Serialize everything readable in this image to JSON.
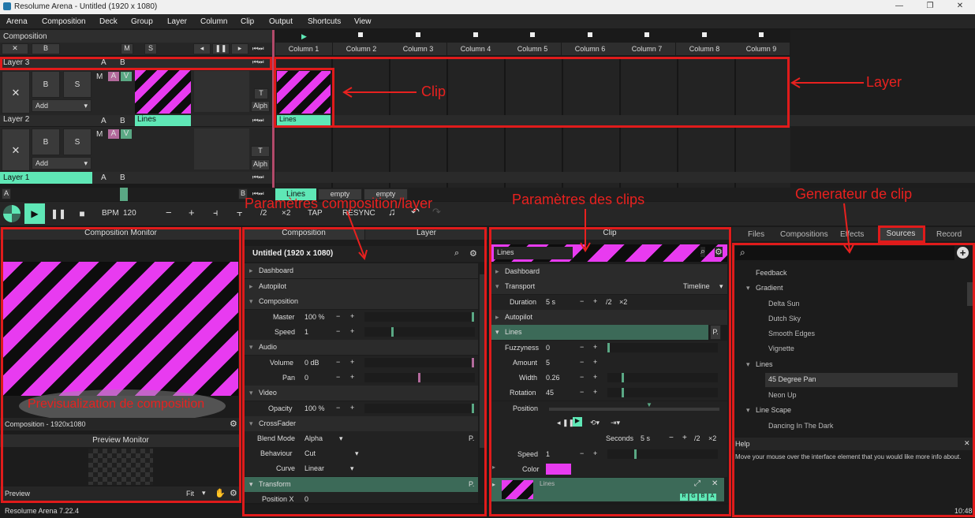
{
  "window": {
    "title": "Resolume Arena - Untitled (1920 x 1080)",
    "minimize": "—",
    "maximize": "❐",
    "close": "✕"
  },
  "menu": [
    "Arena",
    "Composition",
    "Deck",
    "Group",
    "Layer",
    "Column",
    "Clip",
    "Output",
    "Shortcuts",
    "View"
  ],
  "composition": {
    "label": "Composition",
    "x": "✕",
    "b": "B",
    "m": "M",
    "s": "S"
  },
  "columns": [
    "Column 1",
    "Column 2",
    "Column 3",
    "Column 4",
    "Column 5",
    "Column 6",
    "Column 7",
    "Column 8",
    "Column 9"
  ],
  "layers": [
    {
      "name": "Layer 3",
      "a": "A",
      "b": "B"
    },
    {
      "name": "Layer 2",
      "a": "A",
      "b": "B",
      "clip": "Lines",
      "add": "Add",
      "bbtn": "B",
      "sbtn": "S",
      "m": "M",
      "av": "A",
      "v": "V",
      "t": "T",
      "alph": "Alph"
    },
    {
      "name": "Layer 1",
      "a": "A",
      "b": "B",
      "add": "Add",
      "bbtn": "B",
      "sbtn": "S",
      "m": "M",
      "av": "A",
      "v": "V",
      "t": "T",
      "alph": "Alph"
    }
  ],
  "clip_cell": "Lines",
  "deck": {
    "a": "A",
    "b": "B",
    "tabs": [
      "Lines",
      "empty",
      "empty"
    ]
  },
  "transport": {
    "bpm_label": "BPM",
    "bpm": "120",
    "minus": "−",
    "plus": "+",
    "half": "/2",
    "double": "×2",
    "tap": "TAP",
    "resync": "RESYNC"
  },
  "annotations": {
    "clip": "Clip",
    "layer": "Layer",
    "comp_params": "Paramètres composition/layer",
    "clip_params": "Paramètres des clips",
    "generator": "Generateur de clip",
    "preview": "Previsualization de composition"
  },
  "monitor": {
    "title": "Composition Monitor",
    "footer": "Composition - 1920x1080",
    "preview_title": "Preview Monitor",
    "preview_label": "Preview",
    "fit": "Fit"
  },
  "comp_panel": {
    "tab1": "Composition",
    "tab2": "Layer",
    "name": "Untitled (1920 x 1080)",
    "sections": {
      "dashboard": "Dashboard",
      "autopilot": "Autopilot",
      "composition": "Composition",
      "audio": "Audio",
      "video": "Video",
      "crossfader": "CrossFader",
      "transform": "Transform"
    },
    "master_label": "Master",
    "master": "100 %",
    "speed_label": "Speed",
    "speed": "1",
    "volume_label": "Volume",
    "volume": "0 dB",
    "pan_label": "Pan",
    "pan": "0",
    "opacity_label": "Opacity",
    "opacity": "100 %",
    "blend_label": "Blend Mode",
    "blend": "Alpha",
    "behaviour_label": "Behaviour",
    "behaviour": "Cut",
    "curve_label": "Curve",
    "curve": "Linear",
    "posx_label": "Position X",
    "posx": "0",
    "p": "P."
  },
  "clip_panel": {
    "title": "Clip",
    "name": "Lines",
    "dashboard": "Dashboard",
    "transport": "Transport",
    "timeline": "Timeline",
    "duration_label": "Duration",
    "duration": "5 s",
    "half": "/2",
    "double": "×2",
    "autopilot": "Autopilot",
    "lines": "Lines",
    "p": "P.",
    "fuzzyness_label": "Fuzzyness",
    "fuzzyness": "0",
    "amount_label": "Amount",
    "amount": "5",
    "width_label": "Width",
    "width": "0.26",
    "rotation_label": "Rotation",
    "rotation": "45",
    "position_label": "Position",
    "seconds_label": "Seconds",
    "seconds": "5 s",
    "speed_label": "Speed",
    "speed": "1",
    "color_label": "Color",
    "color": "#e83bf0",
    "effect_name": "Lines",
    "rgba": [
      "R",
      "G",
      "B",
      "A"
    ]
  },
  "sources": {
    "tabs": [
      "Files",
      "Compositions",
      "Effects",
      "Sources",
      "Record"
    ],
    "tree": [
      {
        "t": "Feedback",
        "lvl": 0
      },
      {
        "t": "Gradient",
        "lvl": -1
      },
      {
        "t": "Delta Sun",
        "lvl": 1
      },
      {
        "t": "Dutch Sky",
        "lvl": 1
      },
      {
        "t": "Smooth Edges",
        "lvl": 1
      },
      {
        "t": "Vignette",
        "lvl": 1
      },
      {
        "t": "Lines",
        "lvl": -1
      },
      {
        "t": "45 Degree Pan",
        "lvl": 1
      },
      {
        "t": "Neon Up",
        "lvl": 1
      },
      {
        "t": "Line Scape",
        "lvl": -1
      },
      {
        "t": "Dancing In The Dark",
        "lvl": 1
      }
    ],
    "help_title": "Help",
    "help_text": "Move your mouse over the interface element that you would like more info about.",
    "time": "10:48"
  },
  "status": "Resolume Arena 7.22.4"
}
